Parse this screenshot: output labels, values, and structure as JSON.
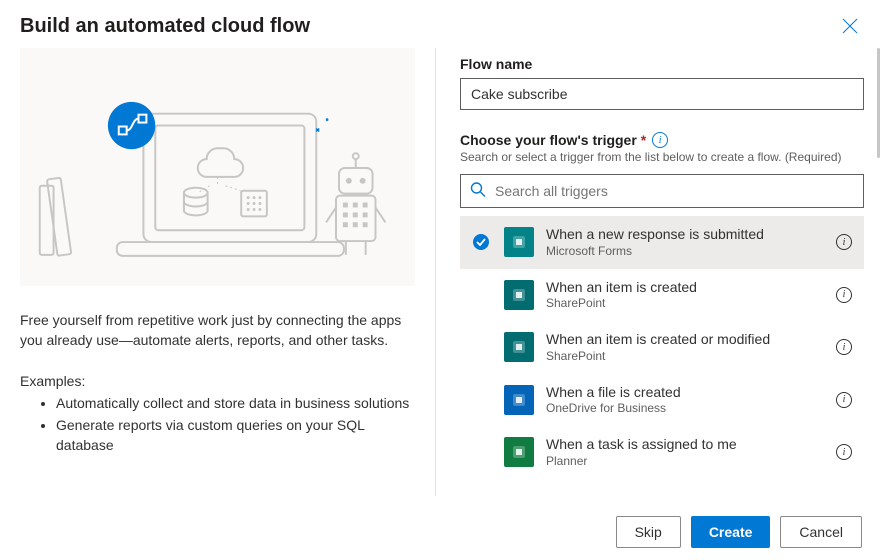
{
  "header": {
    "title": "Build an automated cloud flow"
  },
  "left": {
    "description": "Free yourself from repetitive work just by connecting the apps you already use—automate alerts, reports, and other tasks.",
    "examples_label": "Examples:",
    "examples": [
      "Automatically collect and store data in business solutions",
      "Generate reports via custom queries on your SQL database"
    ]
  },
  "right": {
    "flow_name_label": "Flow name",
    "flow_name_value": "Cake subscribe",
    "trigger_label": "Choose your flow's trigger",
    "trigger_required_mark": "*",
    "trigger_help": "Search or select a trigger from the list below to create a flow. (Required)",
    "search_placeholder": "Search all triggers",
    "triggers": [
      {
        "title": "When a new response is submitted",
        "service": "Microsoft Forms",
        "color": "#038387",
        "selected": true
      },
      {
        "title": "When an item is created",
        "service": "SharePoint",
        "color": "#036c70",
        "selected": false
      },
      {
        "title": "When an item is created or modified",
        "service": "SharePoint",
        "color": "#036c70",
        "selected": false
      },
      {
        "title": "When a file is created",
        "service": "OneDrive for Business",
        "color": "#0364b8",
        "selected": false
      },
      {
        "title": "When a task is assigned to me",
        "service": "Planner",
        "color": "#107c41",
        "selected": false
      }
    ]
  },
  "footer": {
    "skip": "Skip",
    "create": "Create",
    "cancel": "Cancel"
  }
}
